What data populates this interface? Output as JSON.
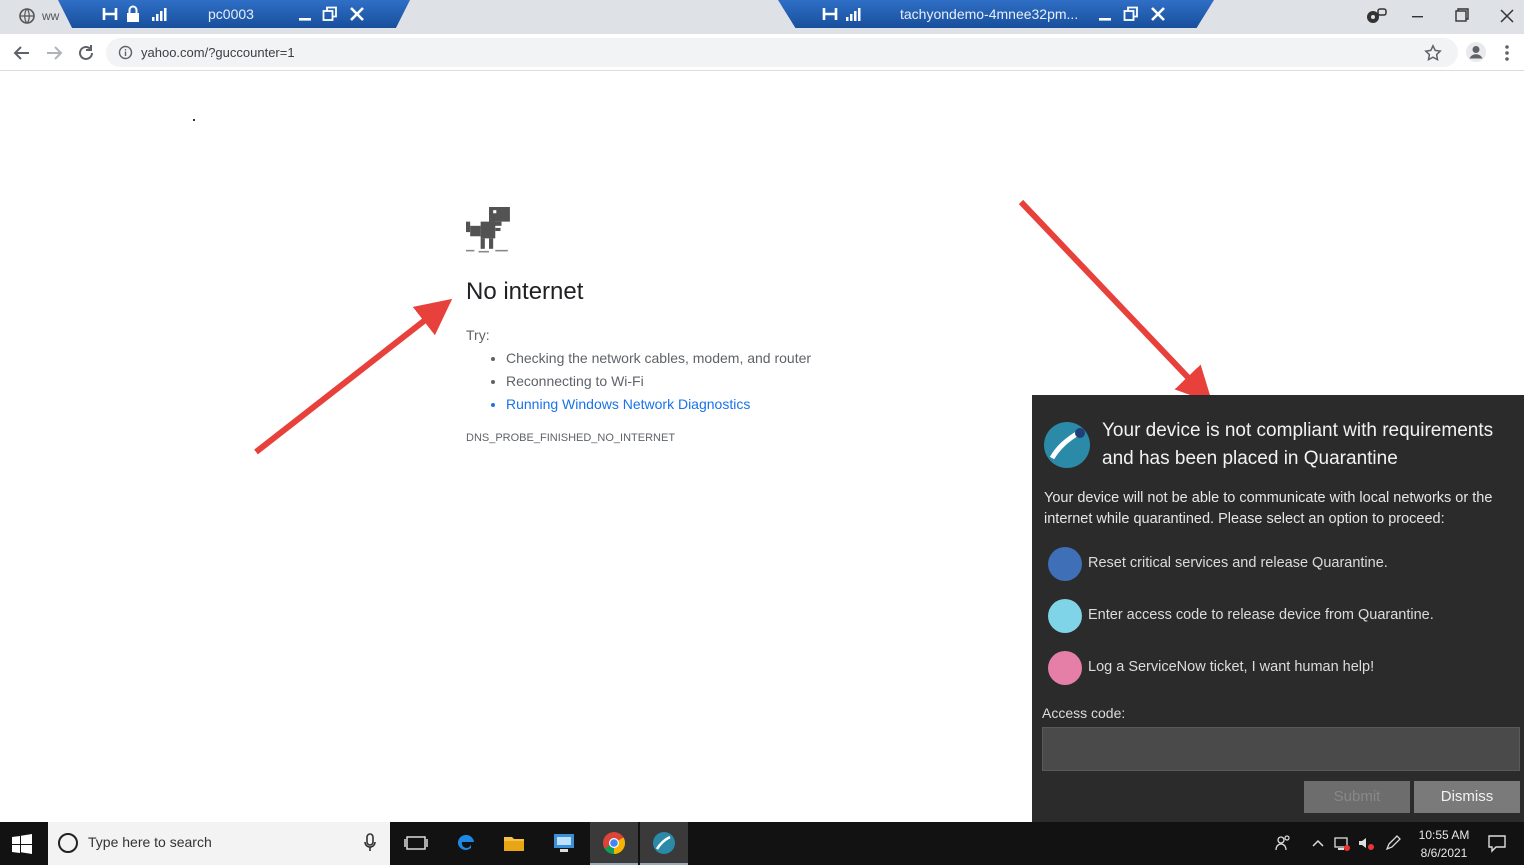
{
  "titlebar": {
    "tab_fragment": "ww",
    "rdp_left_name": "pc0003",
    "rdp_right_name": "tachyondemo-4mnee32pm..."
  },
  "browser": {
    "url": "yahoo.com/?guccounter=1"
  },
  "error_page": {
    "title": "No internet",
    "try_label": "Try:",
    "suggestions": [
      "Checking the network cables, modem, and router",
      "Reconnecting to Wi-Fi",
      "Running Windows Network Diagnostics"
    ],
    "error_code": "DNS_PROBE_FINISHED_NO_INTERNET"
  },
  "quarantine_popup": {
    "title": "Your device is not compliant with requirements and has been placed in Quarantine",
    "description": "Your device will not be able to communicate with local networks or the internet while quarantined. Please select an option to proceed:",
    "options": [
      {
        "label": "Reset critical services and release Quarantine.",
        "color": "#3f6fb6"
      },
      {
        "label": "Enter access code to release device from Quarantine.",
        "color": "#7fd4e8"
      },
      {
        "label": "Log a ServiceNow ticket, I want human help!",
        "color": "#e67fa8"
      }
    ],
    "access_code_label": "Access code:",
    "access_code_value": "",
    "submit_label": "Submit",
    "dismiss_label": "Dismiss"
  },
  "taskbar": {
    "search_placeholder": "Type here to search",
    "time": "10:55 AM",
    "date": "8/6/2021"
  },
  "colors": {
    "annotation_arrow": "#e8413c",
    "link": "#1a73e8",
    "popup_bg": "#2b2b2b"
  }
}
